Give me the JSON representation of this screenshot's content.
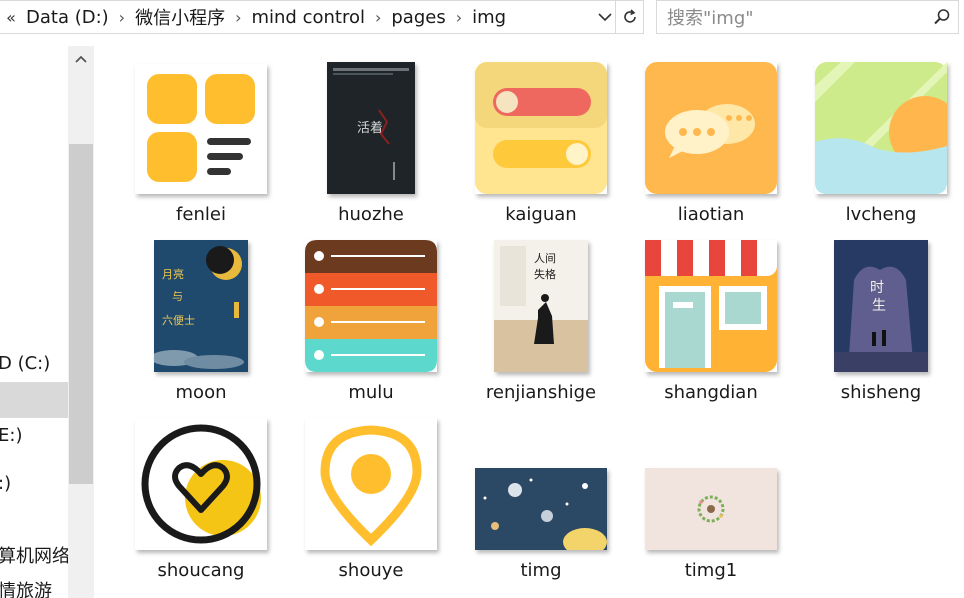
{
  "address_bar": {
    "overflow": "«",
    "crumbs": [
      "Data (D:)",
      "微信小程序",
      "mind control",
      "pages",
      "img"
    ]
  },
  "search": {
    "placeholder": "搜索\"img\""
  },
  "nav_pane": {
    "items": [
      {
        "label": "D (C:)"
      },
      {
        "label": ""
      },
      {
        "label": "E:)"
      },
      {
        "label": ":)"
      },
      {
        "label": "算机网络实"
      },
      {
        "label": "情旅游"
      }
    ]
  },
  "files": [
    {
      "name": "fenlei"
    },
    {
      "name": "huozhe"
    },
    {
      "name": "kaiguan"
    },
    {
      "name": "liaotian"
    },
    {
      "name": "lvcheng"
    },
    {
      "name": "moon"
    },
    {
      "name": "mulu"
    },
    {
      "name": "renjianshige"
    },
    {
      "name": "shangdian"
    },
    {
      "name": "shisheng"
    },
    {
      "name": "shoucang"
    },
    {
      "name": "shouye"
    },
    {
      "name": "timg"
    },
    {
      "name": "timg1"
    }
  ],
  "thumb_text": {
    "huozhe_title": "活着",
    "moon_title": "月亮\n与\n六便士",
    "renjian_title": "人间失格",
    "shisheng_title": "时生"
  },
  "icons": {
    "chevron_left": "double-chevron-left-icon",
    "dropdown": "chevron-down-icon",
    "refresh": "refresh-icon",
    "search": "search-icon",
    "scroll_up": "chevron-up-icon"
  },
  "colors": {
    "yellow": "#FFBE2E",
    "selection": "#d9d9d9",
    "border": "#d9d9d9"
  }
}
